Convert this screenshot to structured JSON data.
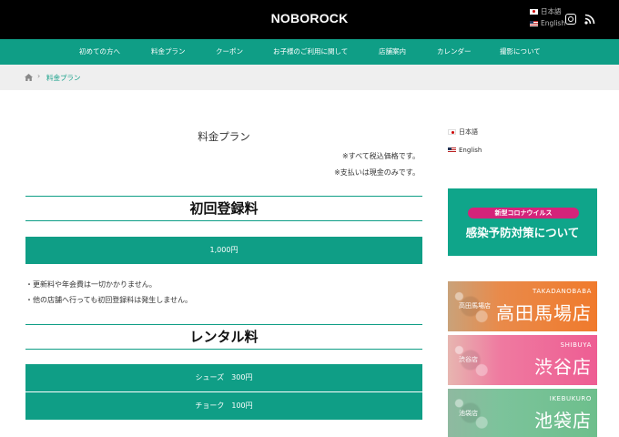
{
  "header": {
    "logo": "NOBOROCK",
    "lang_options": [
      "日本語",
      "English"
    ]
  },
  "nav": {
    "items": [
      "初めての方へ",
      "料金プラン",
      "クーポン",
      "お子様のご利用に関して",
      "店舗案内",
      "カレンダー",
      "撮影について"
    ]
  },
  "breadcrumb": {
    "current": "料金プラン"
  },
  "main": {
    "title": "料金プラン",
    "notes": [
      "※すべて税込価格です。",
      "※支払いは現金のみです。"
    ],
    "registration": {
      "heading": "初回登録料",
      "price": "1,000円",
      "bullets": [
        "・更新料や年会費は一切かかりません。",
        "・他の店舗へ行っても初回登録料は発生しません。"
      ]
    },
    "rental": {
      "heading": "レンタル料",
      "items": [
        "シューズ　300円",
        "チョーク　100円"
      ]
    }
  },
  "sidebar": {
    "lang": [
      "日本語",
      "English"
    ],
    "corona": {
      "pill": "新型コロナウイルス",
      "main": "感染予防対策について"
    },
    "shops": [
      {
        "en": "TAKADANOBABA",
        "jp": "高田馬場店",
        "small": "高田馬場店"
      },
      {
        "en": "SHIBUYA",
        "jp": "渋谷店",
        "small": "渋谷店"
      },
      {
        "en": "IKEBUKURO",
        "jp": "池袋店",
        "small": "池袋店"
      }
    ]
  },
  "colors": {
    "accent": "#0f9e86",
    "header_bg": "#000000",
    "corona_pill": "#d4237a"
  }
}
